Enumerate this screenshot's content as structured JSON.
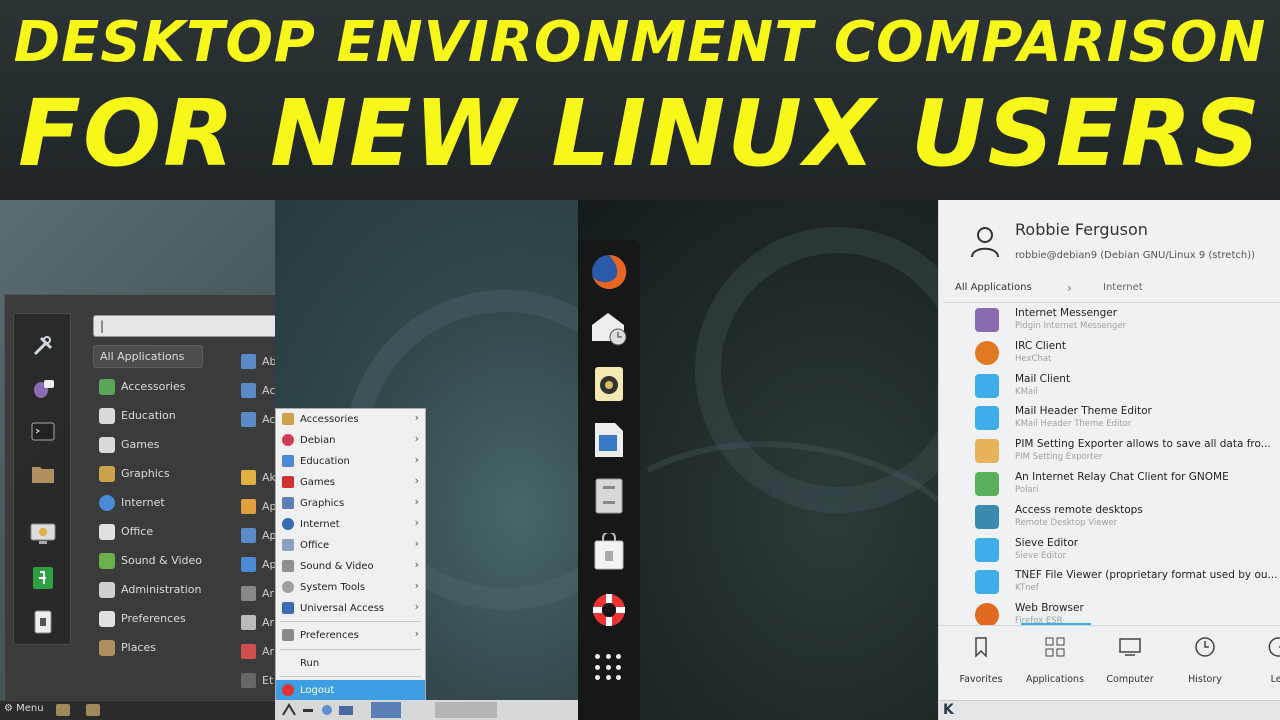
{
  "banner": {
    "line1": "DESKTOP ENVIRONMENT COMPARISON",
    "line2": "FOR NEW LINUX USERS"
  },
  "cinnamon": {
    "search_value": "|",
    "categories": [
      {
        "label": "All Applications",
        "icon": "",
        "color": ""
      },
      {
        "label": "Accessories",
        "icon": "accessories-icon",
        "color": "#5aa55a"
      },
      {
        "label": "Education",
        "icon": "education-icon",
        "color": "#d9d9d9"
      },
      {
        "label": "Games",
        "icon": "games-icon",
        "color": "#d9d9d9"
      },
      {
        "label": "Graphics",
        "icon": "graphics-icon",
        "color": "#c9a24a"
      },
      {
        "label": "Internet",
        "icon": "internet-icon",
        "color": "#4a8ad6"
      },
      {
        "label": "Office",
        "icon": "office-icon",
        "color": "#e0e0e0"
      },
      {
        "label": "Sound & Video",
        "icon": "sound-video-icon",
        "color": "#6ab04c"
      },
      {
        "label": "Administration",
        "icon": "administration-icon",
        "color": "#cfcfcf"
      },
      {
        "label": "Preferences",
        "icon": "preferences-icon",
        "color": "#e0e0e0"
      },
      {
        "label": "Places",
        "icon": "places-icon",
        "color": "#b09060"
      }
    ],
    "app_labels": [
      "Ab",
      "Ac",
      "Ac",
      "",
      "Ak",
      "Ap",
      "Ap",
      "Ap",
      "Ar",
      "Ar",
      "Ar",
      "Et"
    ],
    "taskbar_menu": "Menu"
  },
  "xfce": {
    "items": [
      {
        "label": "Accessories",
        "arrow": "›",
        "color": "#c9a24a"
      },
      {
        "label": "Debian",
        "arrow": "›",
        "color": "#d63a5a"
      },
      {
        "label": "Education",
        "arrow": "›",
        "color": "#4a8ad6"
      },
      {
        "label": "Games",
        "arrow": "›",
        "color": "#d03030"
      },
      {
        "label": "Graphics",
        "arrow": "›",
        "color": "#5a7fb7"
      },
      {
        "label": "Internet",
        "arrow": "›",
        "color": "#3a6ab0"
      },
      {
        "label": "Office",
        "arrow": "›",
        "color": "#8aa0c0"
      },
      {
        "label": "Sound & Video",
        "arrow": "›",
        "color": "#909090"
      },
      {
        "label": "System Tools",
        "arrow": "›",
        "color": "#a0a0a0"
      },
      {
        "label": "Universal Access",
        "arrow": "›",
        "color": "#3a6ab0"
      },
      {
        "label": "Preferences",
        "arrow": "›",
        "color": "#888888"
      },
      {
        "label": "Run",
        "arrow": "",
        "color": ""
      },
      {
        "label": "Logout",
        "arrow": "",
        "color": "#e03030"
      }
    ]
  },
  "gnome": {
    "dock": [
      "firefox-icon",
      "mail-clock-icon",
      "speaker-icon",
      "document-icon",
      "file-cabinet-icon",
      "software-bag-icon",
      "help-lifebuoy-icon"
    ]
  },
  "kde": {
    "user_name": "Robbie Ferguson",
    "user_host": "robbie@debian9 (Debian GNU/Linux 9 (stretch))",
    "crumb_all": "All Applications",
    "crumb_sep": "›",
    "crumb_current": "Internet",
    "apps": [
      {
        "title": "Internet Messenger",
        "subtitle": "Pidgin Internet Messenger",
        "icon": "pidgin-icon",
        "color": "#8a6ab0"
      },
      {
        "title": "IRC Client",
        "subtitle": "HexChat",
        "icon": "hexchat-icon",
        "color": "#e07a20"
      },
      {
        "title": "Mail Client",
        "subtitle": "KMail",
        "icon": "kmail-icon",
        "color": "#3daee9"
      },
      {
        "title": "Mail Header Theme Editor",
        "subtitle": "KMail Header Theme Editor",
        "icon": "kmail-theme-icon",
        "color": "#3daee9"
      },
      {
        "title": "PIM Setting Exporter allows to save all data fro...",
        "subtitle": "PIM Setting Exporter",
        "icon": "pim-exporter-icon",
        "color": "#e8b25a"
      },
      {
        "title": "An Internet Relay Chat Client for GNOME",
        "subtitle": "Polari",
        "icon": "polari-icon",
        "color": "#5ab05a"
      },
      {
        "title": "Access remote desktops",
        "subtitle": "Remote Desktop Viewer",
        "icon": "remote-desktop-icon",
        "color": "#3a8ab0"
      },
      {
        "title": "Sieve Editor",
        "subtitle": "Sieve Editor",
        "icon": "sieve-editor-icon",
        "color": "#3daee9"
      },
      {
        "title": "TNEF File Viewer (proprietary format used by ou...",
        "subtitle": "KTnef",
        "icon": "ktnef-icon",
        "color": "#3daee9"
      },
      {
        "title": "Web Browser",
        "subtitle": "Firefox ESR",
        "icon": "firefox-icon",
        "color": "#e06a20"
      }
    ],
    "tabs": [
      {
        "label": "Favorites",
        "icon": "bookmark-icon"
      },
      {
        "label": "Applications",
        "icon": "applications-grid-icon"
      },
      {
        "label": "Computer",
        "icon": "computer-icon"
      },
      {
        "label": "History",
        "icon": "history-clock-icon"
      },
      {
        "label": "Lea",
        "icon": "leave-icon"
      }
    ],
    "logo": "K"
  }
}
